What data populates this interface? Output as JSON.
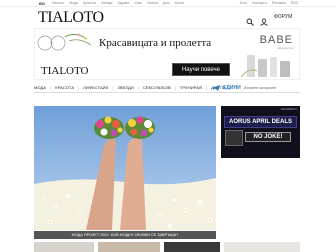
{
  "topbar": {
    "lang": "BG",
    "links": [
      "Начало",
      "Мода",
      "Красота",
      "Звезди",
      "Здраве",
      "Секс",
      "Любов",
      "Дом",
      "Кухня"
    ],
    "right_links": [
      "Блог",
      "Контакти",
      "Реклама",
      "RSS"
    ]
  },
  "header": {
    "logo": "TIALOTO",
    "forum_label": "ФОРУМ"
  },
  "banner": {
    "headline": "Красавицата и пролетта",
    "brand": "BABE",
    "brand_sub": "laboratorios",
    "small_logo": "TIALOTO",
    "cta": "Научи повече"
  },
  "nav": {
    "items": [
      "МОДА",
      "КРАСОТА",
      "ЛИФЕСТАЙЛ",
      "ЗВЕЗДИ",
      "СЕКС/ЛЮБОВ",
      "ТРЕНИРАЙ",
      "ДИЕТИ"
    ],
    "promo_logo": "ЕДИНИ",
    "promo_text": "Изгорете калориите"
  },
  "hero": {
    "caption": "МОДА ПРОЗЕТ 2022: КОЙ МОДЕН ОБУВКИ СЕ ЗАВРЪЩА?"
  },
  "side_ad": {
    "tag": "GEARBEST",
    "line1": "AORUS APRIL DEALS",
    "line2": "NO JOKE!"
  },
  "colors": {
    "ad_bg": "#10101d",
    "caption_bg": "#555555",
    "cta_bg": "#111111",
    "sky": "#8fb6e6",
    "field": "#f4f1e0"
  }
}
